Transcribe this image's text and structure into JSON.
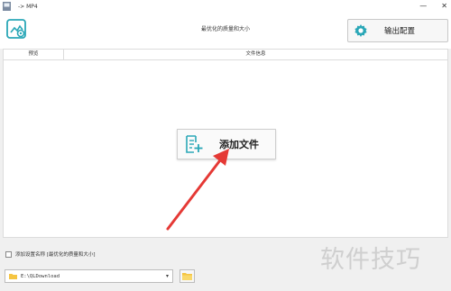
{
  "window": {
    "title": "-> MP4",
    "minimize": "—",
    "close": "✕"
  },
  "header": {
    "title": "最优化的质量和大小",
    "output_button": "输出配置"
  },
  "table": {
    "col_preview": "预览",
    "col_info": "文件信息"
  },
  "main": {
    "add_file_label": "添加文件"
  },
  "footer": {
    "checkbox_label": "添加设置名称 [最优化的质量和大小]",
    "checkbox_checked": false,
    "path_value": "E:\\QLDownload"
  },
  "watermark": "软件技巧",
  "colors": {
    "accent": "#2aa7b7",
    "arrow": "#e53935"
  },
  "icons": {
    "logo": "app-logo-icon",
    "gear": "gear-icon",
    "file_add": "file-add-icon",
    "folder": "folder-icon"
  }
}
